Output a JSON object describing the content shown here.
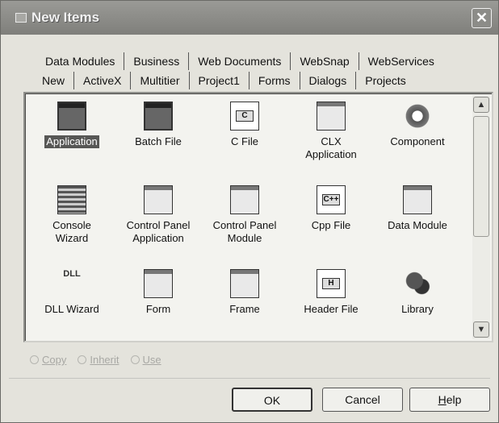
{
  "window": {
    "title": "New Items",
    "close_glyph": "✕"
  },
  "tabs": {
    "row1": [
      "Data Modules",
      "Business",
      "Web Documents",
      "WebSnap",
      "WebServices"
    ],
    "row2": [
      "New",
      "ActiveX",
      "Multitier",
      "Project1",
      "Forms",
      "Dialogs",
      "Projects"
    ],
    "active": "New"
  },
  "items": [
    {
      "label": "Application",
      "icon": "application-icon",
      "selected": true
    },
    {
      "label": "Batch File",
      "icon": "batch-file-icon"
    },
    {
      "label": "C File",
      "icon": "c-file-icon"
    },
    {
      "label": "CLX\nApplication",
      "icon": "clx-application-icon"
    },
    {
      "label": "Component",
      "icon": "component-gear-icon"
    },
    {
      "label": "Console\nWizard",
      "icon": "console-wizard-icon"
    },
    {
      "label": "Control Panel\nApplication",
      "icon": "control-panel-application-icon"
    },
    {
      "label": "Control Panel\nModule",
      "icon": "control-panel-module-icon"
    },
    {
      "label": "Cpp File",
      "icon": "cpp-file-icon"
    },
    {
      "label": "Data Module",
      "icon": "data-module-icon"
    },
    {
      "label": "DLL Wizard",
      "icon": "dll-wizard-icon"
    },
    {
      "label": "Form",
      "icon": "form-icon"
    },
    {
      "label": "Frame",
      "icon": "frame-icon"
    },
    {
      "label": "Header File",
      "icon": "header-file-icon"
    },
    {
      "label": "Library",
      "icon": "library-icon"
    }
  ],
  "icon_text": {
    "c": "C",
    "cpp": "C++",
    "h": "H",
    "dll": "DLL"
  },
  "options": [
    {
      "label": "Copy"
    },
    {
      "label": "Inherit"
    },
    {
      "label": "Use"
    }
  ],
  "buttons": {
    "ok": "OK",
    "cancel": "Cancel",
    "help_prefix": "H",
    "help_rest": "elp"
  },
  "scrollbar": {
    "up": "▲",
    "down": "▼"
  }
}
